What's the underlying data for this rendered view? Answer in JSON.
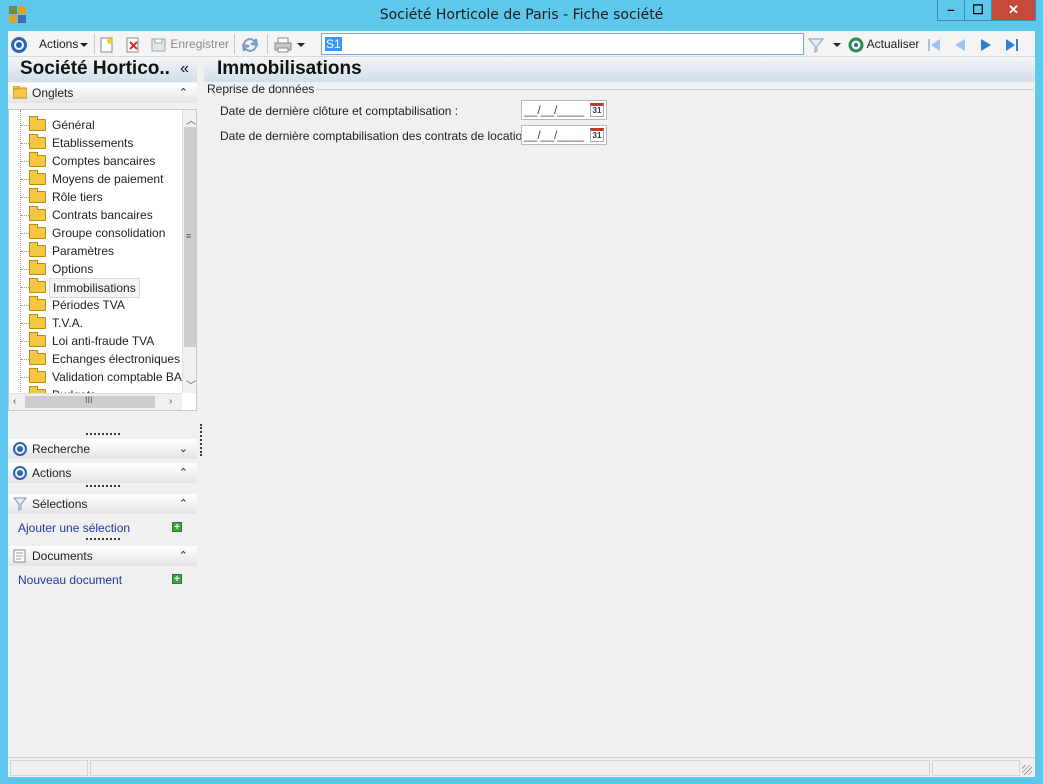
{
  "window": {
    "title": "Société Horticole de Paris -  Fiche société",
    "controls": {
      "minimize": "–",
      "maximize": "☐",
      "close": "✕"
    }
  },
  "toolbar": {
    "actions_label": "Actions",
    "save_label": "Enregistrer",
    "search_value": "S1",
    "refresh_label": "Actualiser"
  },
  "left": {
    "company_title": "Société Hortico..",
    "collapse_glyph": "«",
    "onglets": {
      "label": "Onglets",
      "items": [
        "Général",
        "Etablissements",
        "Comptes bancaires",
        "Moyens de paiement",
        "Rôle tiers",
        "Contrats bancaires",
        "Groupe consolidation",
        "Paramètres",
        "Options",
        "Immobilisations",
        "Périodes TVA",
        "T.V.A.",
        "Loi anti-fraude TVA",
        "Echanges électroniques",
        "Validation comptable BA",
        "Budgets"
      ],
      "selected": "Immobilisations"
    },
    "recherche_label": "Recherche",
    "actions_label": "Actions",
    "selections": {
      "label": "Sélections",
      "add_link": "Ajouter une sélection"
    },
    "documents": {
      "label": "Documents",
      "new_link": "Nouveau document"
    }
  },
  "main": {
    "title": "Immobilisations",
    "group_title": "Reprise de données",
    "fields": [
      {
        "label": "Date de dernière clôture et comptabilisation :",
        "value": "__/__/____"
      },
      {
        "label": "Date de dernière comptabilisation des contrats de location :",
        "value": "__/__/____"
      }
    ],
    "calendar_glyph": "31"
  },
  "icons": {
    "app": "app-icon",
    "actions": "actions-round-icon",
    "new": "new-icon",
    "delete": "delete-icon",
    "save": "save-icon",
    "sync": "sync-icon",
    "print": "print-icon",
    "filter": "filter-icon",
    "refresh": "refresh-icon",
    "first": "first-icon",
    "prev": "previous-icon",
    "next": "next-icon",
    "last": "last-icon"
  },
  "colors": {
    "titlebar": "#5ec8ec",
    "close_button": "#c7493c",
    "link": "#1a3b9e",
    "accent": "#2a66b8"
  }
}
